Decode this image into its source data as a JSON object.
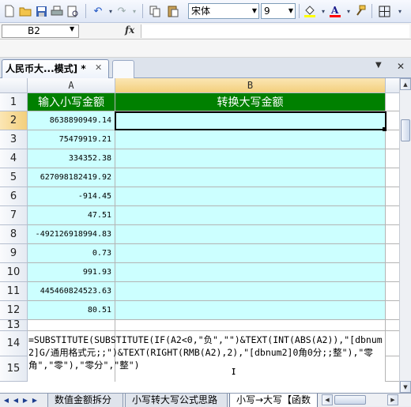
{
  "toolbar": {
    "font_name": "宋体",
    "font_size": "9",
    "buttons": [
      "new",
      "open",
      "save",
      "print",
      "undo",
      "redo",
      "copy",
      "paste",
      "fill-color",
      "font-color",
      "format-painter",
      "borders"
    ]
  },
  "formula_bar": {
    "name_box": "B2",
    "fx_label": "fx",
    "content": ""
  },
  "tabs": {
    "document_tab": "人民币大...模式] *"
  },
  "columns": {
    "A": "A",
    "B": "B"
  },
  "rows": [
    {
      "num": "1",
      "a": "输入小写金额",
      "b": "转换大写金额"
    },
    {
      "num": "2",
      "a": "8638890949.14",
      "b": ""
    },
    {
      "num": "3",
      "a": "75479919.21",
      "b": ""
    },
    {
      "num": "4",
      "a": "334352.38",
      "b": ""
    },
    {
      "num": "5",
      "a": "627098182419.92",
      "b": ""
    },
    {
      "num": "6",
      "a": "-914.45",
      "b": ""
    },
    {
      "num": "7",
      "a": "47.51",
      "b": ""
    },
    {
      "num": "8",
      "a": "-492126918994.83",
      "b": ""
    },
    {
      "num": "9",
      "a": "0.73",
      "b": ""
    },
    {
      "num": "10",
      "a": "991.93",
      "b": ""
    },
    {
      "num": "11",
      "a": "445460824523.63",
      "b": ""
    },
    {
      "num": "12",
      "a": "80.51",
      "b": ""
    },
    {
      "num": "13",
      "a": "",
      "b": ""
    },
    {
      "num": "14",
      "a": "",
      "b": ""
    },
    {
      "num": "15",
      "a": "",
      "b": ""
    }
  ],
  "formula_note": "=SUBSTITUTE(SUBSTITUTE(IF(A2<0,\"负\",\"\")&TEXT(INT(ABS(A2)),\"[dbnum2]G/通用格式元;;\")&TEXT(RIGHT(RMB(A2),2),\"[dbnum2]0角0分;;整\"),\"零角\",\"零\"),\"零分\",\"整\")",
  "sheet_tabs": [
    {
      "label": "数值金额拆分",
      "active": false
    },
    {
      "label": "小写转大写公式思路",
      "active": false
    },
    {
      "label": "小写→大写【函数",
      "active": true
    }
  ],
  "colors": {
    "header_green": "#008000",
    "cell_cyan": "#ccffff"
  }
}
